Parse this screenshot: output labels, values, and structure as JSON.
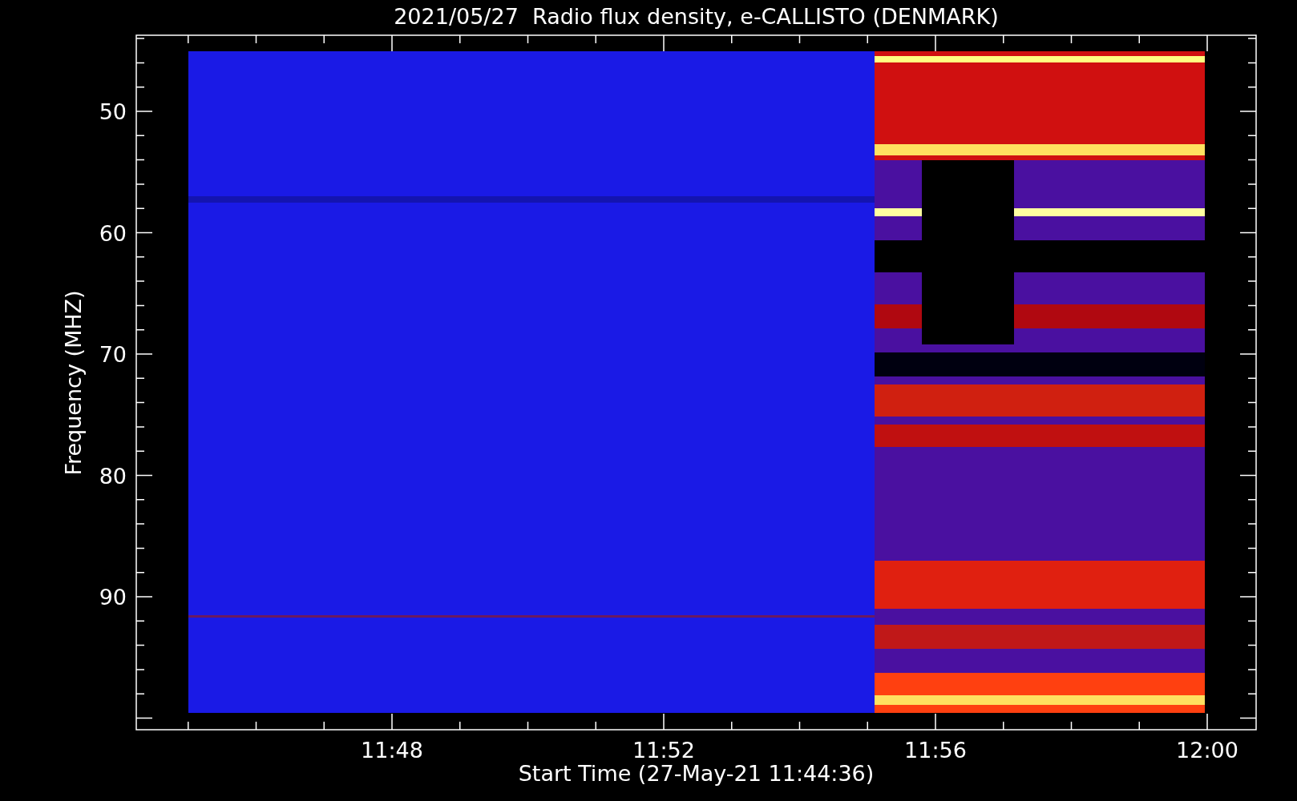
{
  "title": "2021/05/27  Radio flux density, e-CALLISTO (DENMARK)",
  "y_axis": {
    "label": "Frequency (MHZ)",
    "ticks": [
      "50",
      "60",
      "70",
      "80",
      "90"
    ]
  },
  "x_axis": {
    "label": "Start Time (27-May-21 11:44:36)",
    "ticks": [
      "11:48",
      "11:52",
      "11:56",
      "12:00"
    ]
  }
}
